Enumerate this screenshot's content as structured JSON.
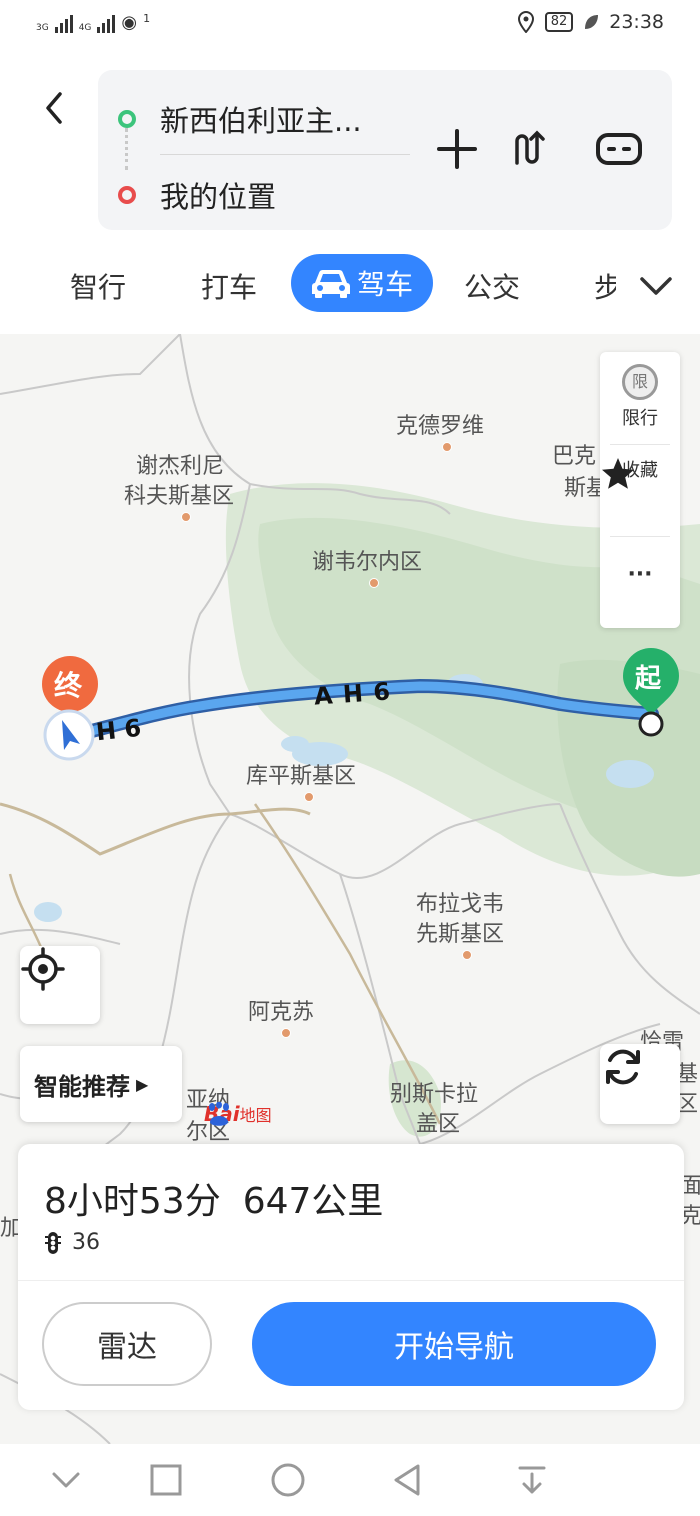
{
  "status": {
    "network1": "3G",
    "network2": "4G",
    "hotspot": "1",
    "battery": "82",
    "time": "23:38"
  },
  "route": {
    "start": "新西伯利亚主...",
    "end": "我的位置",
    "start_color": "#3cc47c",
    "end_color": "#e84c4c"
  },
  "tabs": [
    {
      "label": "智行"
    },
    {
      "label": "打车"
    },
    {
      "label": "驾车",
      "active": true
    },
    {
      "label": "公交"
    },
    {
      "label": "步"
    }
  ],
  "map": {
    "places": [
      {
        "name": "克德罗维"
      },
      {
        "name": "巴克"
      },
      {
        "name": "斯基"
      },
      {
        "name": "谢杰利尼"
      },
      {
        "name": "科夫斯基区"
      },
      {
        "name": "谢韦尔内区"
      },
      {
        "name": "库平斯基区"
      },
      {
        "name": "布拉戈韦"
      },
      {
        "name": "先斯基区"
      },
      {
        "name": "阿克苏"
      },
      {
        "name": "别斯卡拉"
      },
      {
        "name": "盖区"
      },
      {
        "name": "亚纳"
      },
      {
        "name": "尔区"
      },
      {
        "name": "恰雷什"
      },
      {
        "name": "基区"
      },
      {
        "name": "面"
      },
      {
        "name": "克"
      },
      {
        "name": "加"
      }
    ],
    "road_label": "A H 6",
    "road_label_left": "H 6",
    "start_marker": "起",
    "end_marker": "终",
    "side_panel": {
      "restrict_icon": "限",
      "restrict": "限行",
      "favorite": "收藏",
      "more": "···"
    },
    "smart_recommend": "智能推荐",
    "logo_text": "Bai",
    "logo_text2": "地图",
    "accent": "#3385ff"
  },
  "sheet": {
    "duration": "8小时53分",
    "distance": "647公里",
    "traffic_lights": "36",
    "radar": "雷达",
    "start_nav": "开始导航"
  }
}
